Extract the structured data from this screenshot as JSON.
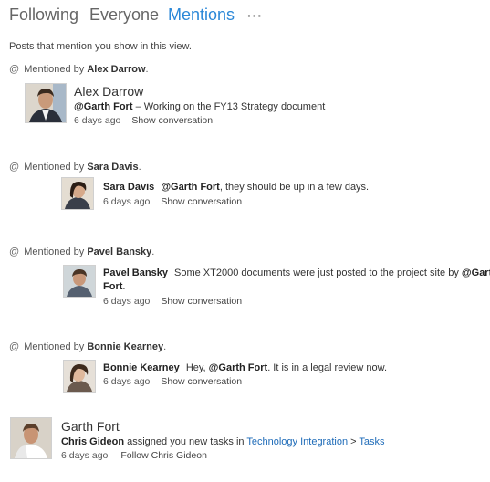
{
  "tabs": [
    {
      "label": "Following"
    },
    {
      "label": "Everyone"
    },
    {
      "label": "Mentions"
    }
  ],
  "more_label": "···",
  "intro": "Posts that mention you show in this view.",
  "mentioned_by_label": "Mentioned by",
  "posts": [
    {
      "mentioner": "Alex Darrow",
      "author": "Alex Darrow",
      "mention": "@Garth Fort",
      "text": " – Working on the FY13 Strategy document",
      "time": "6 days ago",
      "action": "Show conversation"
    },
    {
      "mentioner": "Sara Davis",
      "author": "Sara Davis",
      "mention": "@Garth Fort",
      "text": ", they should be up in a few days.",
      "time": "6 days ago",
      "action": "Show conversation"
    },
    {
      "mentioner": "Pavel Bansky",
      "author": "Pavel Bansky",
      "text_before": "Some XT2000 documents were just posted to the project site by ",
      "mention": "@Garth",
      "mention_cont": "Fort",
      "text": ".",
      "time": "6 days ago",
      "action": "Show conversation"
    },
    {
      "mentioner": "Bonnie Kearney",
      "author": "Bonnie Kearney",
      "text_before": "Hey, ",
      "mention": "@Garth Fort",
      "text": ". It is in a legal review now.",
      "time": "6 days ago",
      "action": "Show conversation"
    }
  ],
  "activity": {
    "name": "Garth Fort",
    "actor": "Chris Gideon",
    "text": " assigned you new tasks in ",
    "link1": "Technology Integration",
    "sep": " > ",
    "link2": "Tasks",
    "time": "6 days ago",
    "action": "Follow Chris Gideon"
  },
  "colors": {
    "accent": "#2b88d8",
    "link": "#1e6bb8",
    "text": "#444444"
  }
}
